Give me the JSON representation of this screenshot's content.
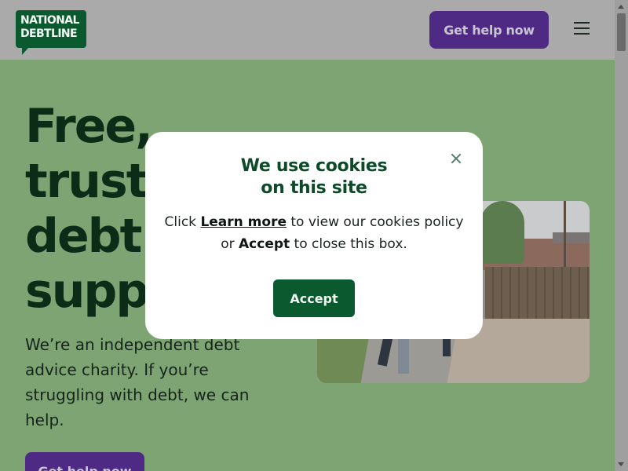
{
  "header": {
    "logo": {
      "line1": "NATIONAL",
      "line2": "DEBTLINE"
    },
    "cta_label": "Get help now",
    "menu_icon": "hamburger-menu-icon"
  },
  "hero": {
    "title_lines": [
      "Free,",
      "truste",
      "debt",
      "suppo"
    ],
    "subtitle": "We’re an independent debt advice charity. If you’re struggling with debt, we can help.",
    "cta_label": "Get help now"
  },
  "cookie_modal": {
    "title_line1": "We use cookies",
    "title_line2": "on this site",
    "text_part1": "Click ",
    "learn_more": "Learn more",
    "text_part2": " to view our cookies policy or ",
    "accept_word": "Accept",
    "text_part3": " to close this box.",
    "accept_label": "Accept",
    "close_icon": "close-icon"
  },
  "colors": {
    "brand_green": "#0b5a2f",
    "cta_purple": "#4f2a85",
    "hero_bg": "#7ea474"
  }
}
